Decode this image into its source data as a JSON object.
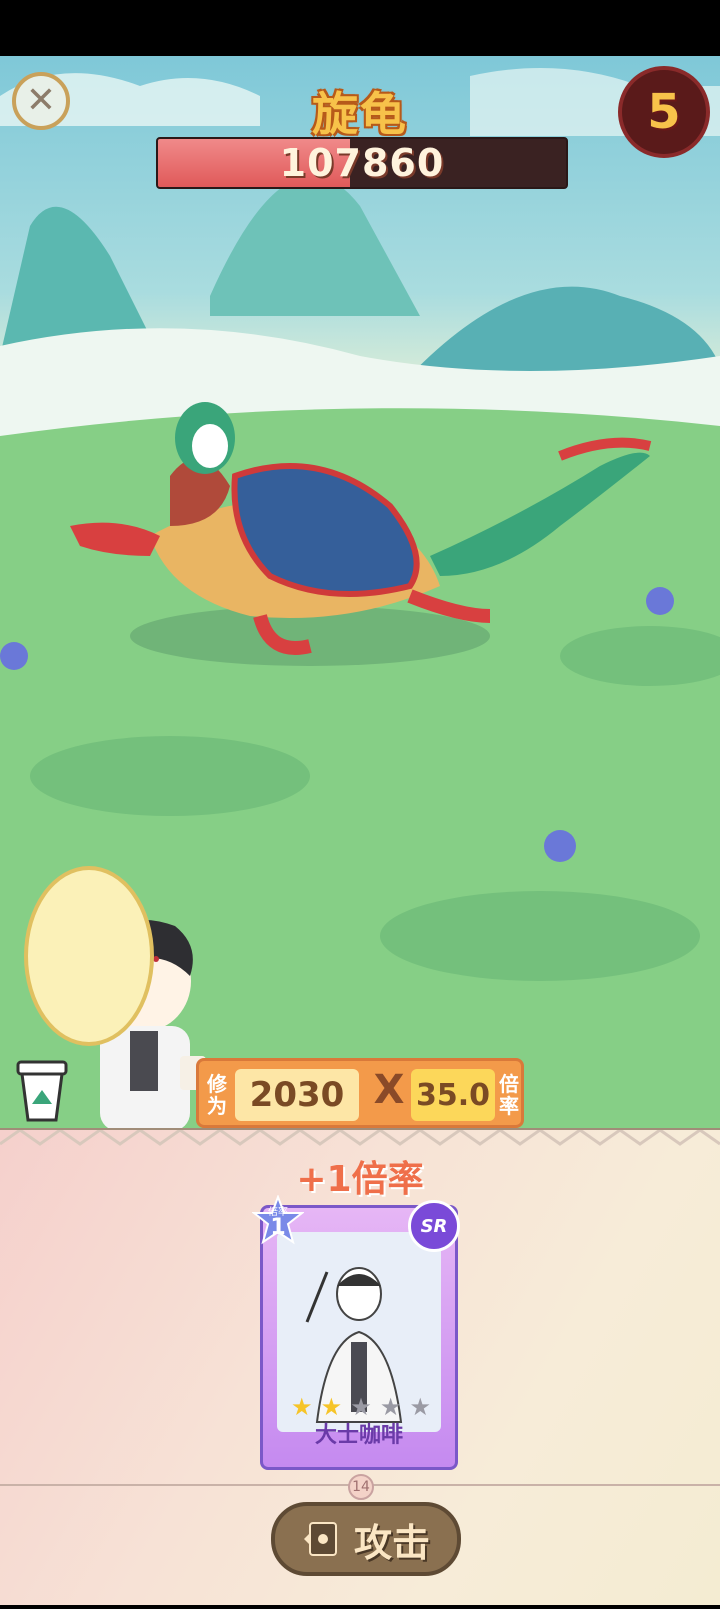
{
  "boss": {
    "name": "旋龟",
    "hp": "107860",
    "hp_fraction": 0.47
  },
  "round": {
    "value": "5"
  },
  "close_icon": "close-icon",
  "stats": {
    "cultivation_label": "修为",
    "cultivation_value": "2030",
    "operator": "X",
    "multiplier_value": "35.0",
    "multiplier_label": "倍率"
  },
  "bonus": {
    "text": "+1倍率"
  },
  "card": {
    "rate_label": "倍率",
    "rate_value": "1",
    "rarity": "SR",
    "name": "大士咖啡",
    "stars_filled": 2,
    "stars_total": 5
  },
  "deck_count": "14",
  "attack_button": {
    "label": "攻击",
    "icon": "card-icon"
  },
  "colors": {
    "accent": "#f39a4a",
    "hp": "#e05a5a",
    "card": "#c58af0"
  }
}
